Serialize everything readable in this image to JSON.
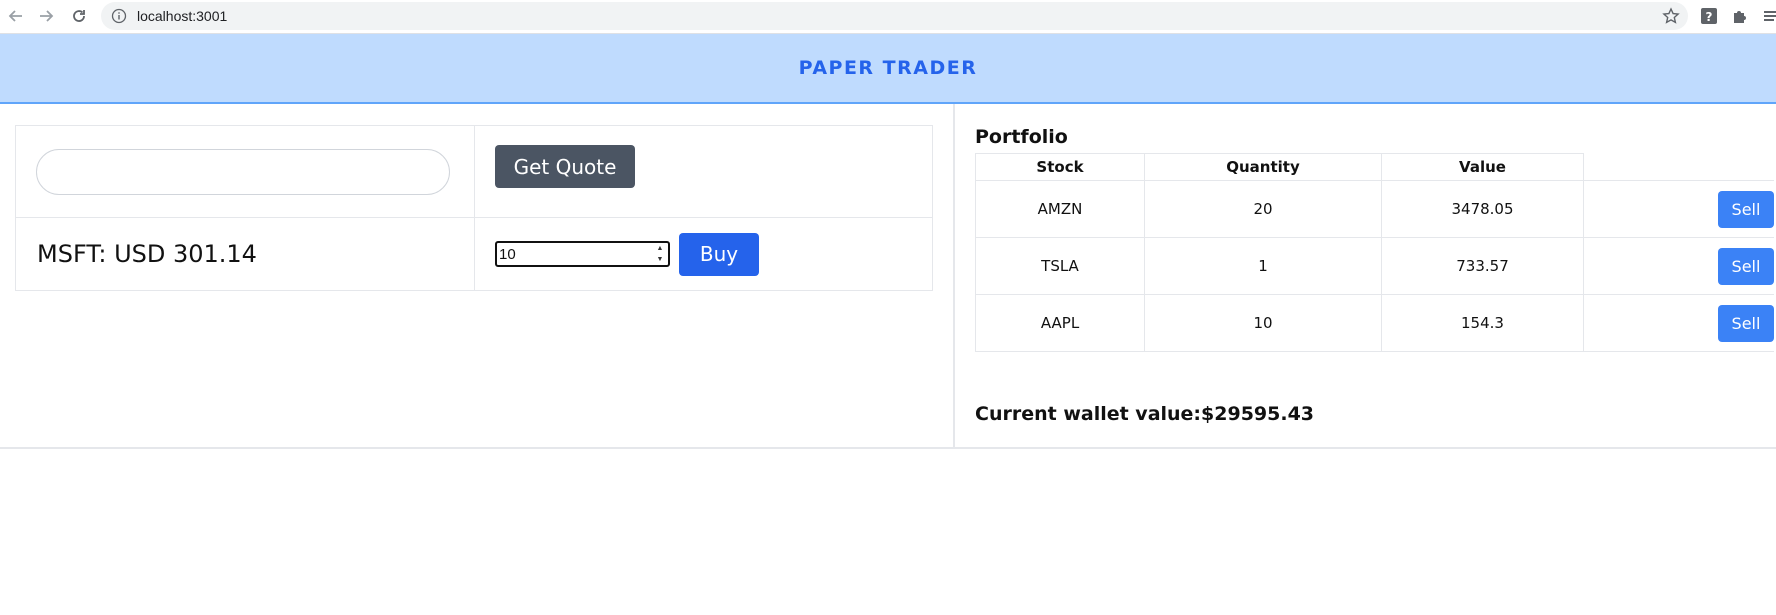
{
  "browser": {
    "url": "localhost:3001",
    "icons": [
      "back-icon",
      "forward-icon",
      "reload-icon",
      "info-icon",
      "star-icon",
      "help-extension-icon",
      "puzzle-icon",
      "menu-icon"
    ]
  },
  "app": {
    "title": "PAPER TRADER",
    "colors": {
      "header_bg": "#bfdbfe",
      "header_text": "#2563eb",
      "buy": "#2563eb",
      "sell": "#3b82f6",
      "quote": "#4b5563"
    }
  },
  "trade": {
    "symbol_value": "",
    "get_quote_label": "Get Quote",
    "quote_text": "MSFT: USD 301.14",
    "quantity_value": "10",
    "buy_label": "Buy"
  },
  "portfolio": {
    "title": "Portfolio",
    "columns": [
      "Stock",
      "Quantity",
      "Value"
    ],
    "rows": [
      {
        "stock": "AMZN",
        "quantity": "20",
        "value": "3478.05",
        "action": "Sell"
      },
      {
        "stock": "TSLA",
        "quantity": "1",
        "value": "733.57",
        "action": "Sell"
      },
      {
        "stock": "AAPL",
        "quantity": "10",
        "value": "154.3",
        "action": "Sell"
      }
    ],
    "wallet_text": "Current wallet value:$29595.43"
  }
}
